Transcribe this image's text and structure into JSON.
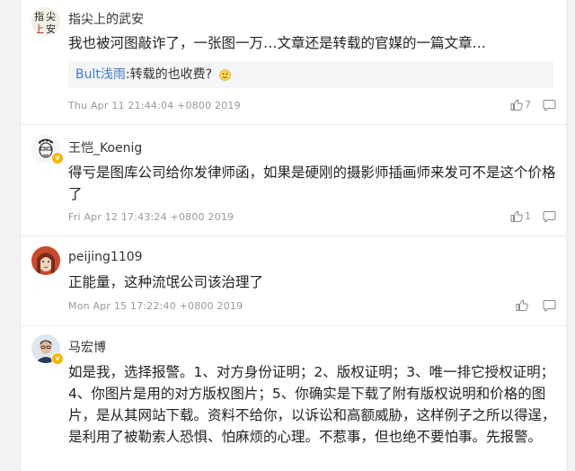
{
  "comments": [
    {
      "name": "指尖上的武安",
      "text": "我也被河图敲诈了，一张图一万…文章还是转载的官媒的一篇文章…",
      "quote_name": "Bult浅雨",
      "quote_text": ":转载的也收费?",
      "time": "Thu Apr 11 21:44:04 +0800 2019",
      "likes": "7",
      "avatar_chars": [
        "指",
        "尖",
        "上",
        "安"
      ]
    },
    {
      "name": "王恺_Koenig",
      "text": "得亏是图库公司给你发律师函，如果是硬刚的摄影师插画师来发可不是这个价格了",
      "time": "Fri Apr 12 17:43:24 +0800 2019",
      "likes": "1",
      "badge": "v"
    },
    {
      "name": "peijing1109",
      "text": "正能量，这种流氓公司该治理了",
      "time": "Mon Apr 15 17:22:40 +0800 2019",
      "likes": ""
    },
    {
      "name": "马宏博",
      "text": "如是我，选择报警。1、对方身份证明；2、版权证明；3、唯一排它授权证明；4、你图片是用的对方版权图片；5、你确实是下载了附有版权说明和价格的图片，是从其网站下载。资料不给你，以诉讼和高额威胁，这样例子之所以得逞，是利用了被勒索人恐惧、怕麻烦的心理。不惹事，但也绝不要怕事。先报警。",
      "badge": "v"
    }
  ],
  "colors": {
    "name": "#333333",
    "time": "#999999",
    "quote_name": "#3d7bc9",
    "badge": "#f7b500"
  },
  "icons": {
    "like": "thumbs-up-icon",
    "reply": "comment-bubble-icon"
  }
}
